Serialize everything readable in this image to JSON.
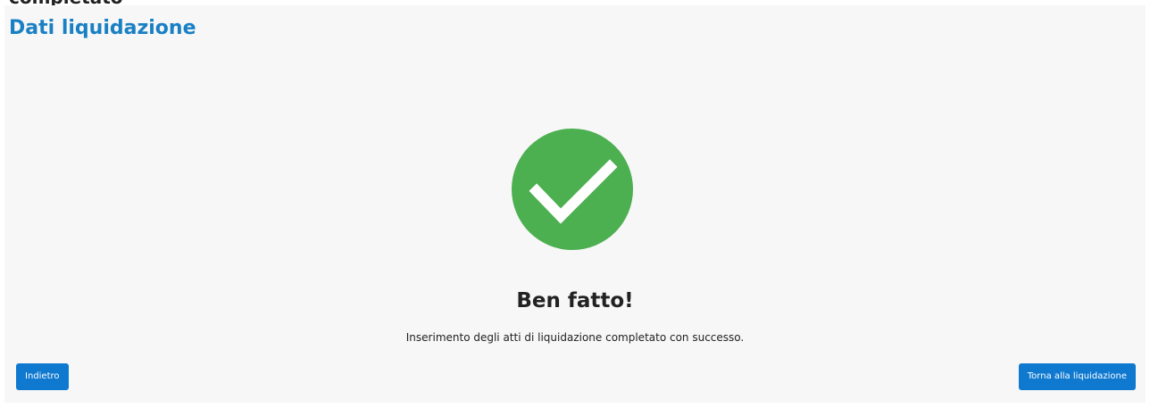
{
  "top_cut_heading": "completato",
  "page_title": "Dati liquidazione",
  "success": {
    "heading": "Ben fatto!",
    "message": "Inserimento degli atti di liquidazione completato con successo.",
    "icon": "check-circle-icon",
    "icon_color": "#4caf50"
  },
  "buttons": {
    "back_label": "Indietro",
    "return_label": "Torna alla liquidazione"
  },
  "colors": {
    "accent": "#1a80c4",
    "button": "#0f79d0"
  }
}
